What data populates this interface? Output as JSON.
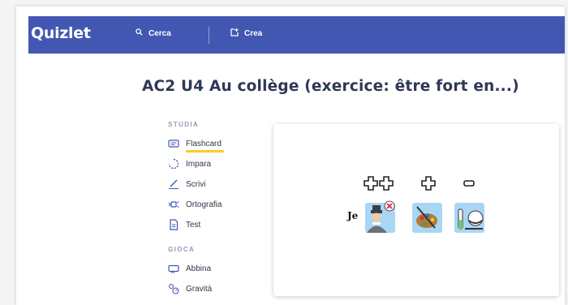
{
  "header": {
    "logo": "Quizlet",
    "search_label": "Cerca",
    "create_label": "Crea",
    "search_icon": "search-icon",
    "create_icon": "create-icon"
  },
  "title": "AC2 U4 Au collège (exercice: être fort en...)",
  "sidebar": {
    "study_label": "STUDIA",
    "study_items": [
      {
        "label": "Flashcard",
        "icon": "flashcard-icon",
        "active": true
      },
      {
        "label": "Impara",
        "icon": "learn-icon"
      },
      {
        "label": "Scrivi",
        "icon": "write-icon"
      },
      {
        "label": "Ortografia",
        "icon": "spell-icon"
      },
      {
        "label": "Test",
        "icon": "test-icon"
      }
    ],
    "play_label": "GIOCA",
    "play_items": [
      {
        "label": "Abbina",
        "icon": "match-icon"
      },
      {
        "label": "Gravità",
        "icon": "gravity-icon"
      }
    ]
  },
  "card": {
    "word": "Je",
    "symbols": [
      "plus-plus-symbol",
      "plus-symbol",
      "minus-symbol"
    ],
    "pictograms": [
      "person-pictogram",
      "painting-pictogram",
      "science-pictogram"
    ]
  },
  "colors": {
    "brand": "#4257b2",
    "accent": "#ffcd1f",
    "title": "#2e3856",
    "muted": "#939bb4",
    "pictogram_bg": "#a9d6f5"
  }
}
